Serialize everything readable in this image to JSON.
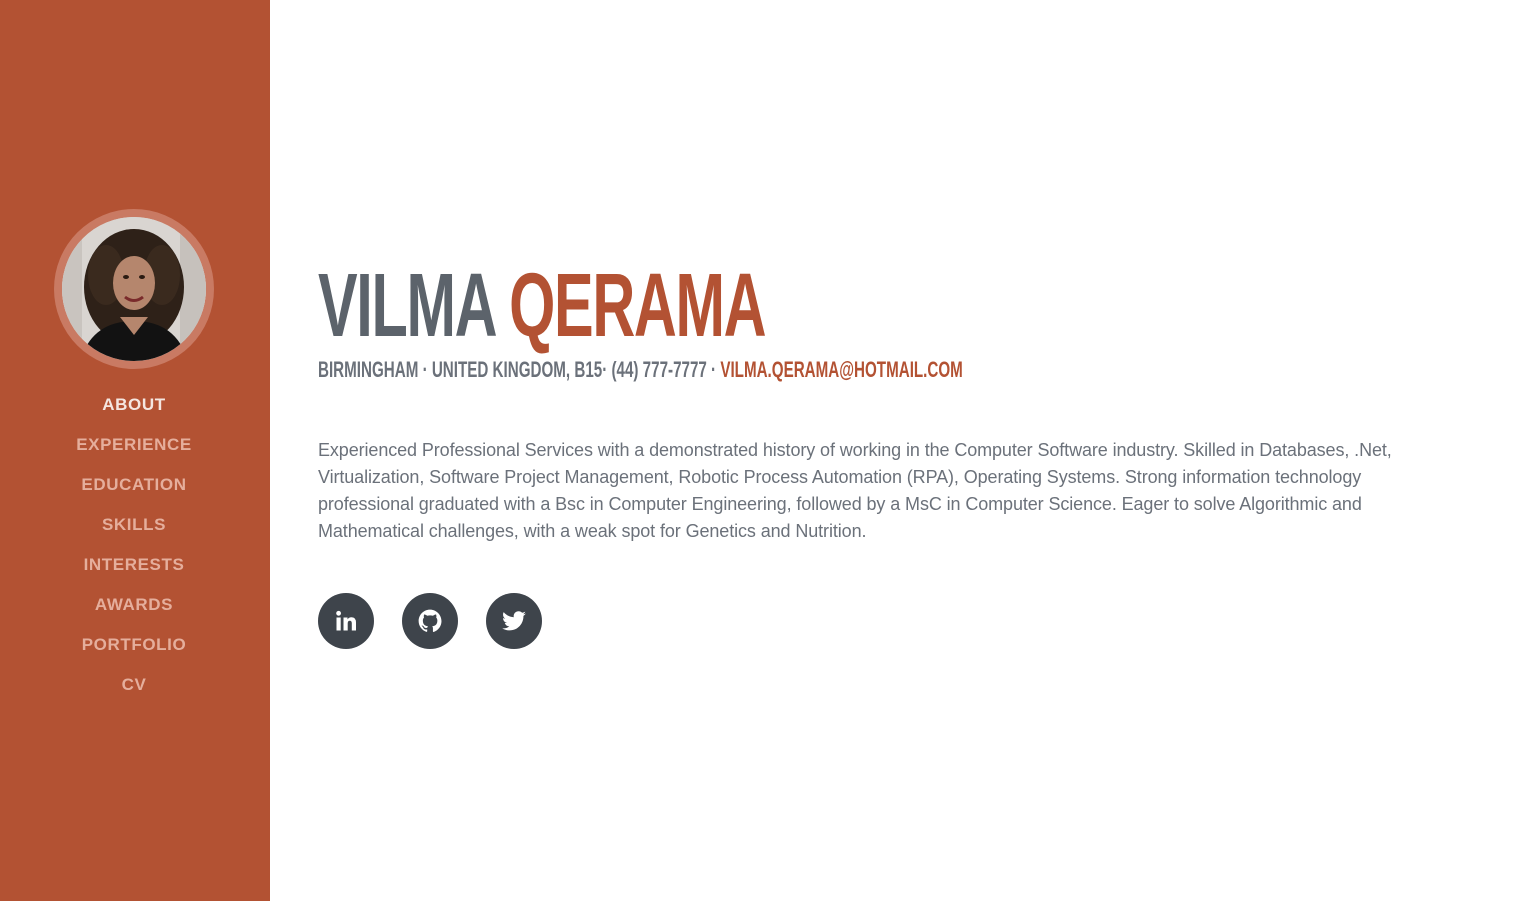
{
  "sidebar": {
    "avatar_alt": "Profile photo",
    "nav": [
      {
        "label": "ABOUT",
        "active": true
      },
      {
        "label": "EXPERIENCE",
        "active": false
      },
      {
        "label": "EDUCATION",
        "active": false
      },
      {
        "label": "SKILLS",
        "active": false
      },
      {
        "label": "INTERESTS",
        "active": false
      },
      {
        "label": "AWARDS",
        "active": false
      },
      {
        "label": "PORTFOLIO",
        "active": false
      },
      {
        "label": "CV",
        "active": false
      }
    ]
  },
  "about": {
    "first_name": "VILMA",
    "last_name": "QERAMA",
    "address": "BIRMINGHAM · UNITED KINGDOM, B15· (44) 777-7777 · ",
    "email": "VILMA.QERAMA@HOTMAIL.COM",
    "summary": "Experienced Professional Services with a demonstrated history of working in the Computer Software industry. Skilled in Databases, .Net, Virtualization, Software Project Management, Robotic Process Automation (RPA), Operating Systems. Strong information technology professional graduated with a Bsc in Computer Engineering, followed by a MsC in Computer Science. Eager to solve Algorithmic and Mathematical challenges, with a weak spot for Genetics and Nutrition.",
    "social": [
      {
        "icon": "linkedin-icon"
      },
      {
        "icon": "github-icon"
      },
      {
        "icon": "twitter-icon"
      }
    ]
  },
  "colors": {
    "sidebar_bg": "#b35233",
    "accent": "#b35233",
    "name_gray": "#5c636b",
    "text_gray": "#6b717a",
    "social_bg": "#3e444b",
    "nav_inactive": "#e5ae9c",
    "nav_active": "#f5e6e0"
  }
}
